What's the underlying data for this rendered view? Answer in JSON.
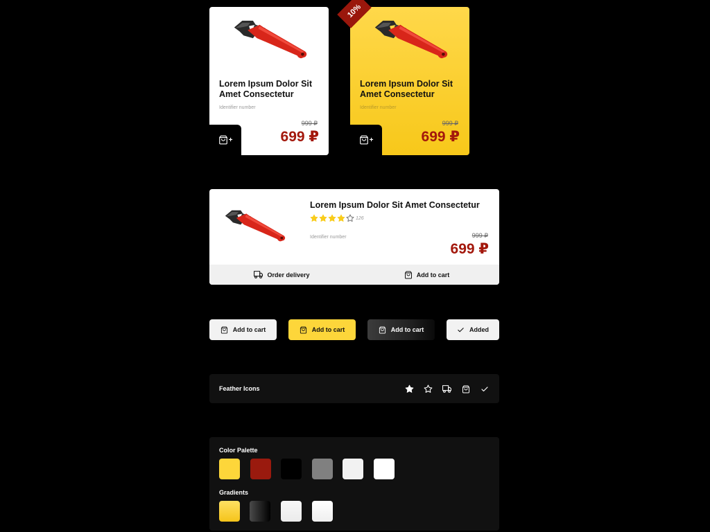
{
  "cards": [
    {
      "variant": "white",
      "title": "Lorem Ipsum Dolor Sit Amet Consectetur",
      "identifier": "Identifier number",
      "old_price": "999 ₽",
      "price": "699 ₽",
      "cart_plus": "+"
    },
    {
      "variant": "yellow",
      "discount_tag": "10%",
      "title": "Lorem Ipsum Dolor Sit Amet Consectetur",
      "identifier": "Identifier number",
      "old_price": "999 ₽",
      "price": "699 ₽",
      "cart_plus": "+"
    }
  ],
  "wide_card": {
    "title": "Lorem Ipsum Dolor Sit Amet Consectetur",
    "rating": 4,
    "rating_max": 5,
    "review_count": "126",
    "identifier": "Identifier number",
    "old_price": "999 ₽",
    "price": "699 ₽",
    "order_delivery_label": "Order delivery",
    "add_to_cart_label": "Add to cart"
  },
  "buttons": [
    {
      "variant": "white",
      "label": "Add to cart",
      "icon": "shopping-bag-icon"
    },
    {
      "variant": "yellow",
      "label": "Add to cart",
      "icon": "shopping-bag-icon"
    },
    {
      "variant": "dark",
      "label": "Add to cart",
      "icon": "shopping-bag-icon"
    },
    {
      "variant": "added",
      "label": "Added",
      "icon": "check-icon"
    }
  ],
  "icons_panel": {
    "label": "Feather Icons",
    "icons": [
      "star-filled-icon",
      "star-icon",
      "truck-icon",
      "shopping-bag-icon",
      "check-icon"
    ]
  },
  "palette": {
    "label": "Color Palette",
    "colors": [
      "#fdd63a",
      "#9a1a0e",
      "#000000",
      "#808080",
      "#f2f2f2",
      "#ffffff"
    ]
  },
  "gradients": {
    "label": "Gradients",
    "items": [
      "yellow-gradient",
      "dark-gradient",
      "light-gradient",
      "white-gradient"
    ]
  },
  "theme": {
    "background": "#000000",
    "accent_yellow": "#fdd63a",
    "accent_red": "#a3180c",
    "panel_bg": "#111111"
  }
}
